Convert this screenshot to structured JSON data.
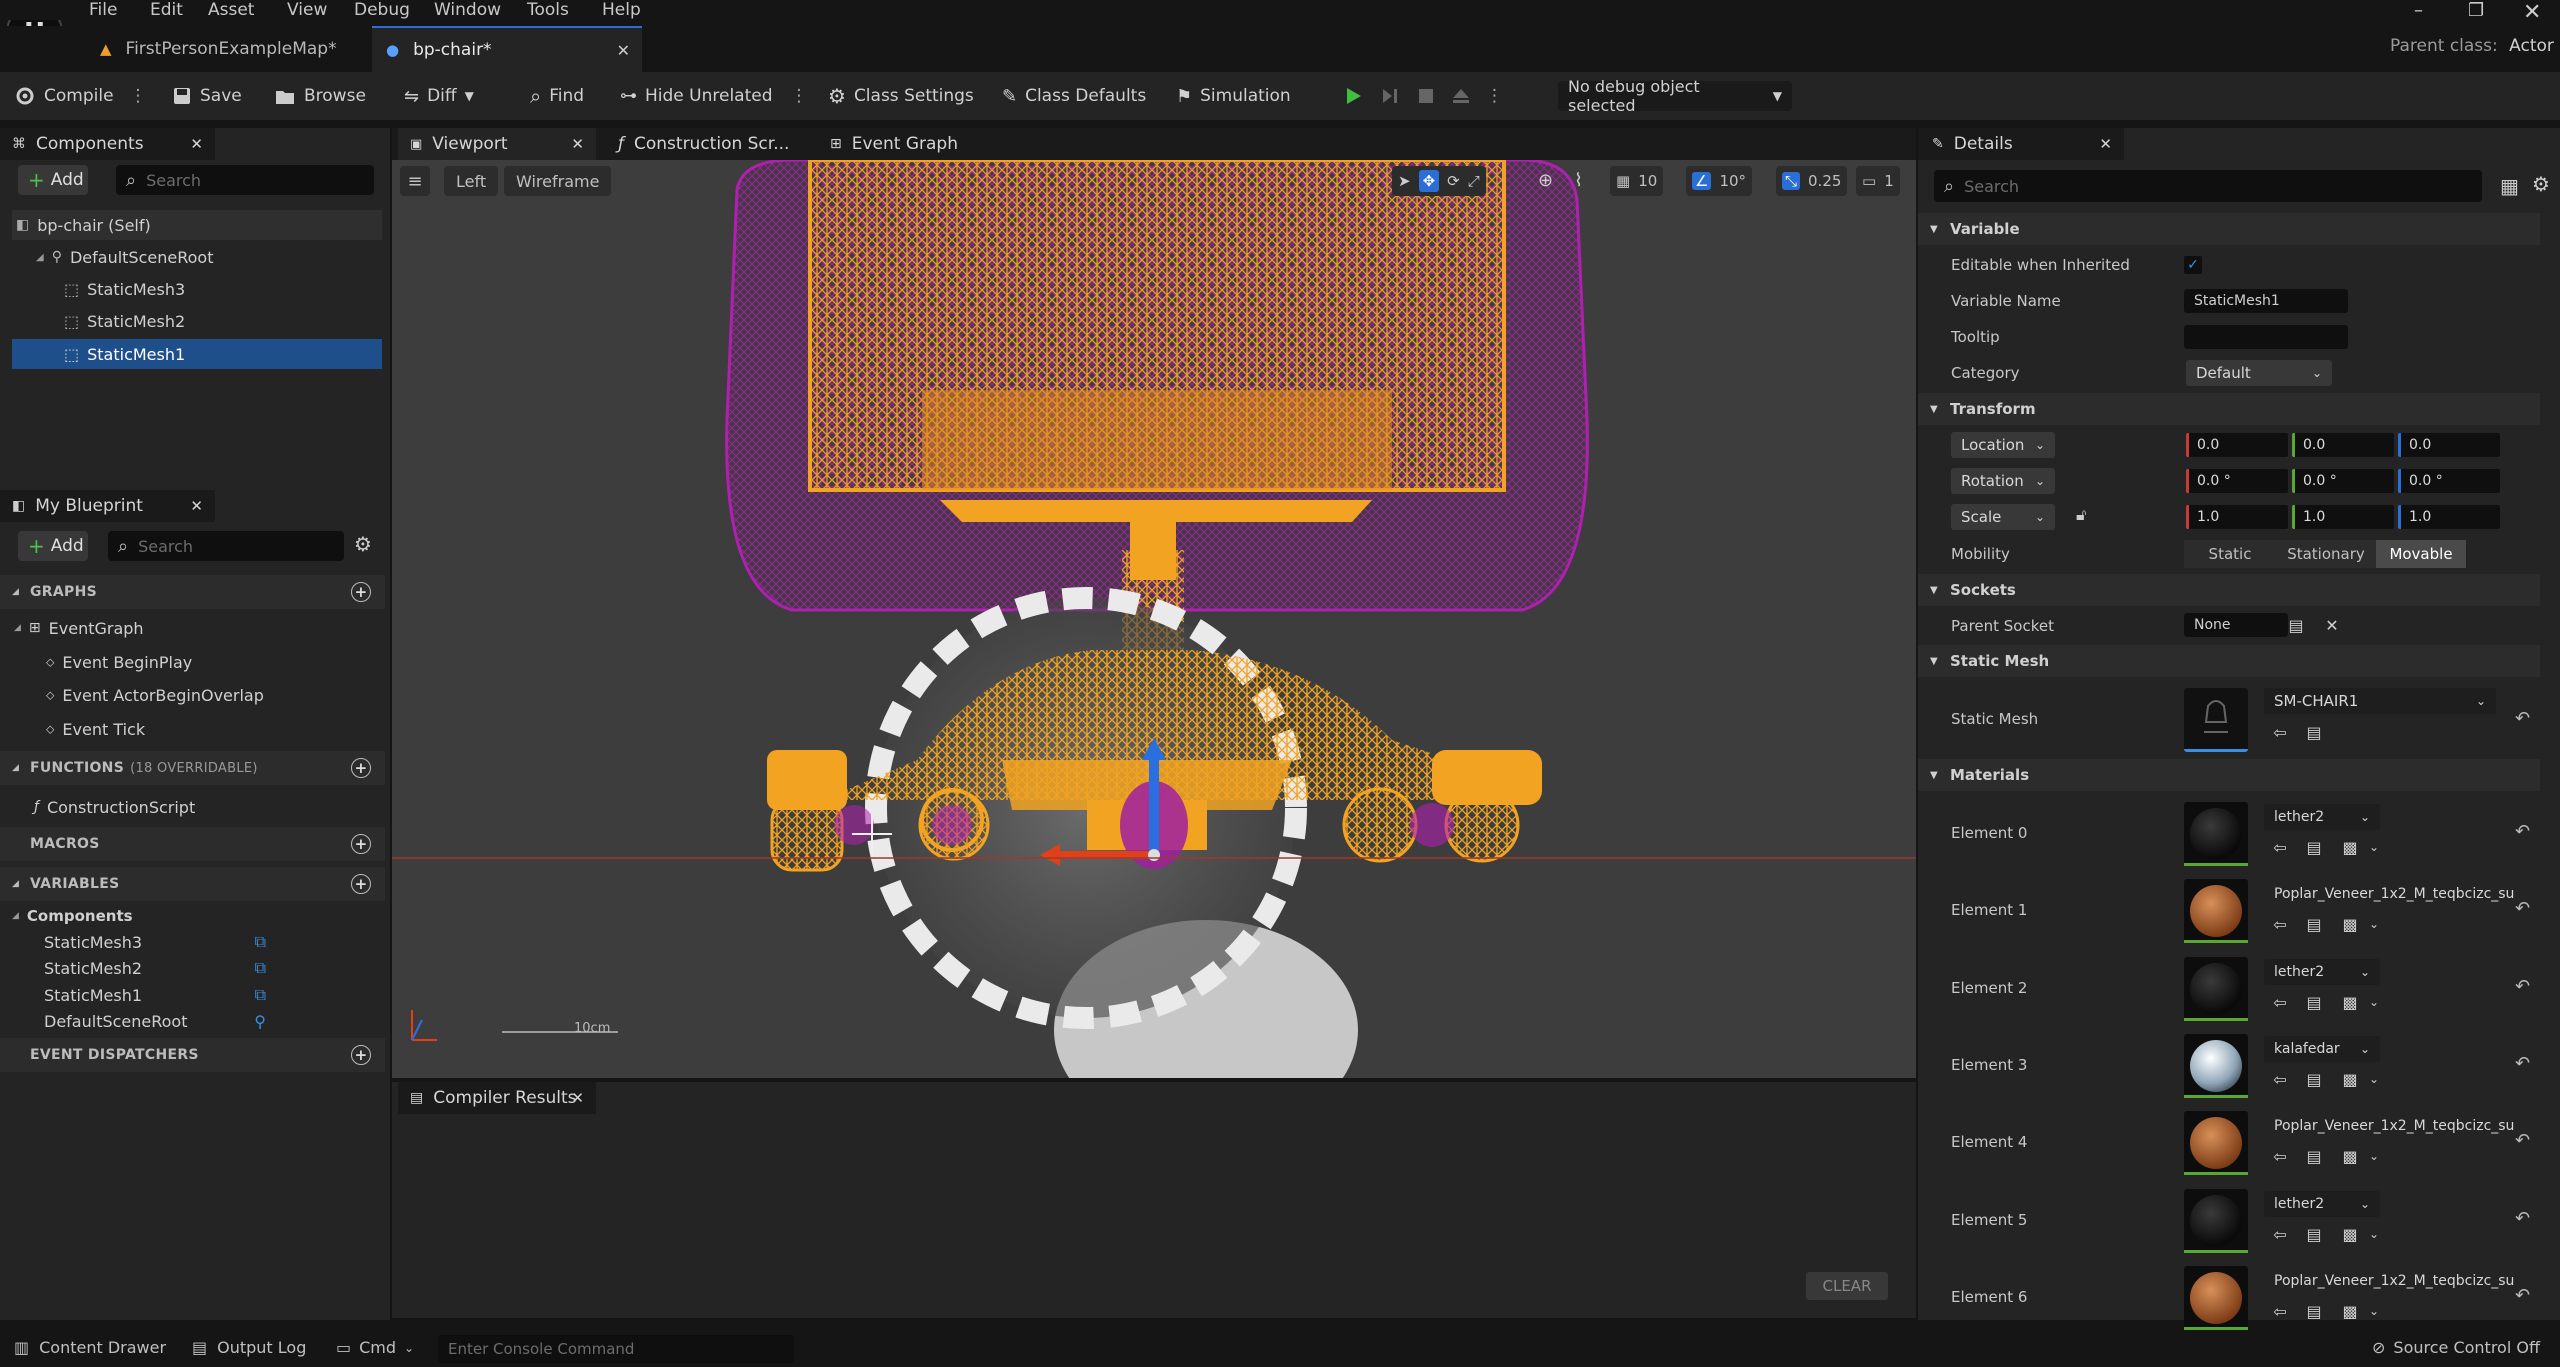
{
  "menu": [
    "File",
    "Edit",
    "Asset",
    "View",
    "Debug",
    "Window",
    "Tools",
    "Help"
  ],
  "logo": "U",
  "tabs": [
    {
      "label": "FirstPersonExampleMap*",
      "icon": "level-icon"
    },
    {
      "label": "bp-chair*",
      "icon": "blueprint-icon"
    }
  ],
  "parent_class": {
    "label": "Parent class:",
    "value": "Actor"
  },
  "toolbar": {
    "compile": "Compile",
    "save": "Save",
    "browse": "Browse",
    "diff": "Diff",
    "find": "Find",
    "hide_unrelated": "Hide Unrelated",
    "class_settings": "Class Settings",
    "class_defaults": "Class Defaults",
    "simulation": "Simulation",
    "debug_object": "No debug object selected"
  },
  "components_panel": {
    "title": "Components",
    "add": "Add",
    "search_placeholder": "Search",
    "items": [
      "bp-chair (Self)",
      "DefaultSceneRoot",
      "StaticMesh3",
      "StaticMesh2",
      "StaticMesh1"
    ]
  },
  "myblueprint": {
    "title": "My Blueprint",
    "add": "Add",
    "search_placeholder": "Search",
    "graphs_label": "GRAPHS",
    "event_graph": "EventGraph",
    "events": [
      "Event BeginPlay",
      "Event ActorBeginOverlap",
      "Event Tick"
    ],
    "functions_label": "FUNCTIONS",
    "functions_count": "(18 OVERRIDABLE)",
    "construction_script": "ConstructionScript",
    "macros_label": "MACROS",
    "variables_label": "VARIABLES",
    "components_label": "Components",
    "variables": [
      "StaticMesh3",
      "StaticMesh2",
      "StaticMesh1",
      "DefaultSceneRoot"
    ],
    "dispatchers_label": "EVENT DISPATCHERS"
  },
  "center_tabs": [
    "Viewport",
    "Construction Scr...",
    "Event Graph"
  ],
  "viewport": {
    "view_mode": "Left",
    "render_mode": "Wireframe",
    "grid_snap": "10",
    "rot_snap": "10°",
    "scale_snap": "0.25",
    "camera_speed": "1",
    "scale_label": "10cm"
  },
  "compiler": {
    "title": "Compiler Results",
    "clear": "CLEAR"
  },
  "details": {
    "title": "Details",
    "search_placeholder": "Search",
    "variable_section": "Variable",
    "editable_label": "Editable when Inherited",
    "variable_name_label": "Variable Name",
    "variable_name": "StaticMesh1",
    "tooltip_label": "Tooltip",
    "category_label": "Category",
    "category": "Default",
    "transform_section": "Transform",
    "location_label": "Location",
    "location": [
      "0.0",
      "0.0",
      "0.0"
    ],
    "rotation_label": "Rotation",
    "rotation": [
      "0.0 °",
      "0.0 °",
      "0.0 °"
    ],
    "scale_label": "Scale",
    "scale": [
      "1.0",
      "1.0",
      "1.0"
    ],
    "mobility_label": "Mobility",
    "mobility": [
      "Static",
      "Stationary",
      "Movable"
    ],
    "sockets_section": "Sockets",
    "parent_socket_label": "Parent Socket",
    "parent_socket": "None",
    "static_mesh_section": "Static Mesh",
    "static_mesh_label": "Static Mesh",
    "static_mesh": "SM-CHAIR1",
    "materials_section": "Materials",
    "materials": [
      {
        "label": "Element 0",
        "value": "lether2",
        "kind": "dark"
      },
      {
        "label": "Element 1",
        "value": "Poplar_Veneer_1x2_M_teqbcizc_su",
        "kind": "wood"
      },
      {
        "label": "Element 2",
        "value": "lether2",
        "kind": "dark"
      },
      {
        "label": "Element 3",
        "value": "kalafedar",
        "kind": "metal"
      },
      {
        "label": "Element 4",
        "value": "Poplar_Veneer_1x2_M_teqbcizc_su",
        "kind": "wood"
      },
      {
        "label": "Element 5",
        "value": "lether2",
        "kind": "dark"
      },
      {
        "label": "Element 6",
        "value": "Poplar_Veneer_1x2_M_teqbcizc_su",
        "kind": "wood"
      }
    ]
  },
  "statusbar": {
    "content_drawer": "Content Drawer",
    "output_log": "Output Log",
    "cmd": "Cmd",
    "console_placeholder": "Enter Console Command",
    "source_control": "Source Control Off"
  },
  "colors": {
    "accent": "#2a6fd6",
    "wire_orange": "#f0a020",
    "wire_magenta": "#b020b0",
    "selected": "#1f4f8a"
  }
}
